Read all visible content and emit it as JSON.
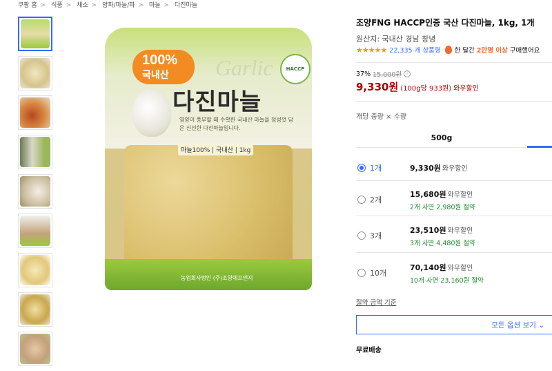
{
  "breadcrumb": [
    "쿠팡 홈",
    "식품",
    "채소",
    "양파/마늘/파",
    "마늘",
    "다진마늘"
  ],
  "package": {
    "badge_pct": "100%",
    "badge_domestic": "국내산",
    "script": "Garlic",
    "title": "다진마늘",
    "desc": "영양이 풍부할 때 수확한 국내산 마늘을 정성껏 담은 신선한 다진마늘입니다.",
    "spec": "마늘100% | 국내산 | 1kg",
    "haccp": "HACCP",
    "maker": "농업회사법인 (주)조양에프엔지"
  },
  "product": {
    "title": "조양FNG HACCP인증 국산 다진마늘, 1kg, 1개",
    "origin": "원산지: 국내산 경남 창녕",
    "stars": "★★★★★",
    "review_count": "22,335 개 상품평",
    "hot_prefix": "한 달간",
    "hot_count": "2만명 이상",
    "hot_suffix": "구매했어요",
    "discount_rate": "37%",
    "original_price": "15,000원",
    "info_icon": "i",
    "price": "9,330원",
    "unit_price": "(100g당 933원)",
    "price_tag": "와우할인"
  },
  "options": {
    "label": "개당 중량 × 수량",
    "tab": "500g",
    "items": [
      {
        "qty": "1개",
        "price": "9,330원",
        "tag": "와우할인",
        "save": ""
      },
      {
        "qty": "2개",
        "price": "15,680원",
        "tag": "와우할인",
        "save": "2개 사면 2,980원 절약"
      },
      {
        "qty": "3개",
        "price": "23,510원",
        "tag": "와우할인",
        "save": "3개 사면 4,480원 절약"
      },
      {
        "qty": "10개",
        "price": "70,140원",
        "tag": "와우할인",
        "save": "10개 사면 23,160원 절약"
      }
    ],
    "criteria_link": "절약 금액 기준",
    "all_options_button": "모든 옵션 보기 ⌄"
  },
  "shipping": "무료배송",
  "colors": {
    "accent": "#346aff",
    "price": "#ae0000",
    "save": "#1d8a2e",
    "star": "#f39c00"
  }
}
